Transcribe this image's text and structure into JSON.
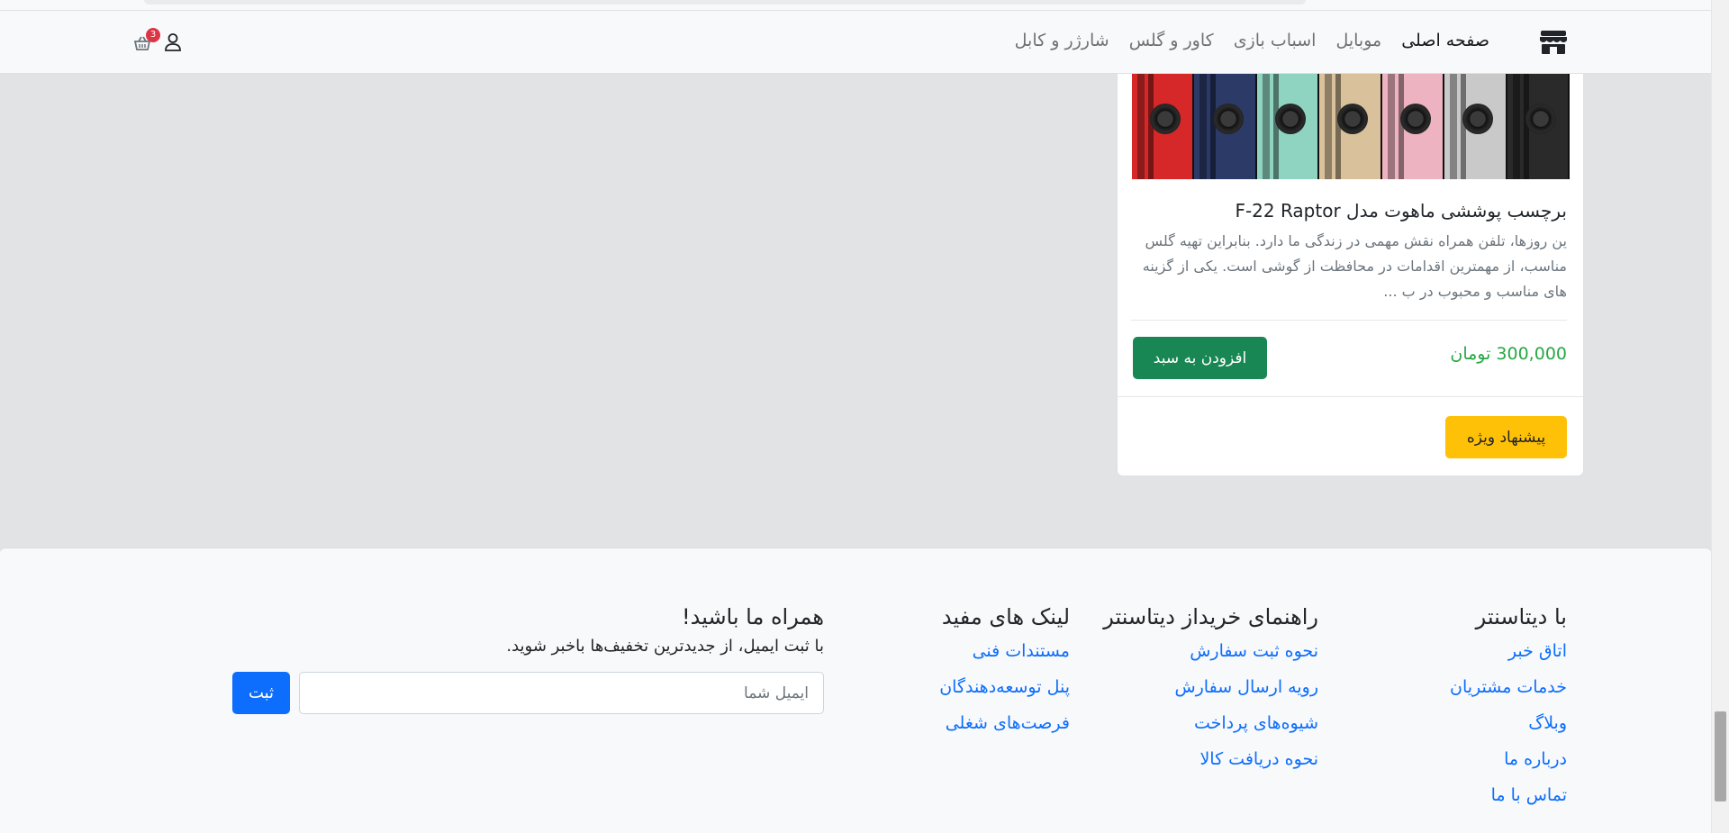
{
  "nav": {
    "brand_icon": "shop-icon",
    "links": [
      {
        "label": "صفحه اصلی",
        "active": true
      },
      {
        "label": "موبایل",
        "active": false
      },
      {
        "label": "اسباب بازی",
        "active": false
      },
      {
        "label": "کاور و گلس",
        "active": false
      },
      {
        "label": "شارژر و کابل",
        "active": false
      }
    ],
    "user_icon": "person-icon",
    "cart_icon": "basket-icon",
    "cart_count": "3"
  },
  "product": {
    "image_icon": "phone-cases-image",
    "case_colors": [
      "#d62828",
      "#2b3a67",
      "#8fd3c1",
      "#d9c29b",
      "#eeb3c0",
      "#c9c9c9",
      "#2a2a2a"
    ],
    "title": "برچسب پوششی ماهوت مدل F-22 Raptor",
    "description": "ین روزها، تلفن همراه نقش مهمی در زندگی ما دارد. بنابراین تهیه گلس مناسب، از مهمترین اقدامات در محافظت از گوشی است. یکی از گزینه های مناسب و محبوب در ب ...",
    "price": "300,000 تومان",
    "add_to_cart": "افزودن به سبد",
    "special_offer": "پیشنهاد ویژه"
  },
  "footer": {
    "col1": {
      "title": "با دیتاسنتر",
      "links": [
        "اتاق خبر",
        "خدمات مشتریان",
        "وبلاگ",
        "درباره ما",
        "تماس با ما"
      ]
    },
    "col2": {
      "title": "راهنمای خریداز دیتاسنتر",
      "links": [
        "نحوه ثبت سفارش",
        "رویه ارسال سفارش",
        "شیوه‌های پرداخت",
        "نحوه دریافت کالا"
      ]
    },
    "col3": {
      "title": "لینک های مفید",
      "links": [
        "مستندات فنی",
        "پنل توسعه‌دهندگان",
        "فرصت‌های شغلی"
      ]
    },
    "newsletter": {
      "title": "همراه ما باشید!",
      "description": "با ثبت ایمیل، از جدیدترین تخفیف‌ها باخبر شوید.",
      "placeholder": "ایمیل شما",
      "value": "",
      "submit": "ثبت"
    }
  },
  "colors": {
    "primary": "#0d6efd",
    "success": "#198754",
    "price": "#28a745",
    "warning": "#ffc107",
    "badge": "#dc3545"
  }
}
